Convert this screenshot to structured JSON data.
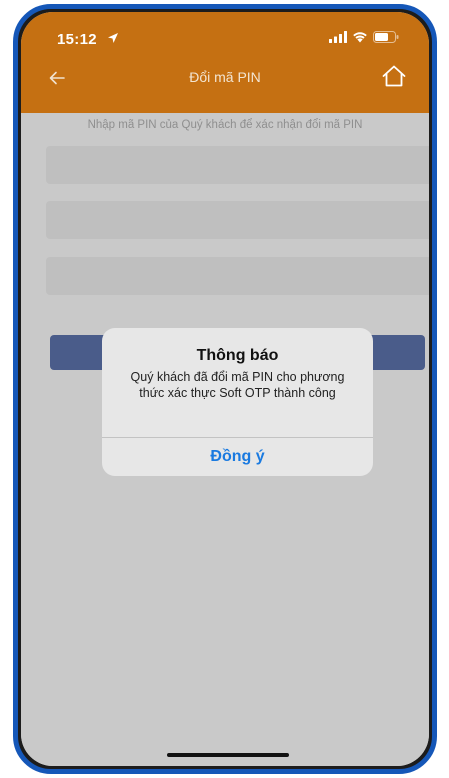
{
  "status_bar": {
    "time": "15:12",
    "icons": [
      "location-arrow-icon",
      "signal-icon",
      "wifi-icon",
      "battery-icon"
    ]
  },
  "nav": {
    "title": "Đổi mã PIN",
    "back_icon": "arrow-left-icon",
    "home_icon": "home-icon"
  },
  "form": {
    "instruction": "Nhập mã PIN của Quý khách để xác nhận đổi mã PIN",
    "fields": [
      {
        "value": "",
        "placeholder": ""
      },
      {
        "value": "",
        "placeholder": ""
      },
      {
        "value": "",
        "placeholder": ""
      }
    ]
  },
  "alert": {
    "title": "Thông báo",
    "message": "Quý khách đã đổi mã PIN cho phương thức xác thực Soft OTP thành công",
    "ok_label": "Đồng ý"
  },
  "colors": {
    "header": "#c57012",
    "frame": "#1557b8",
    "overlay": "#c9c9c9",
    "button": "#4a5c8a",
    "link": "#1a7ae0"
  }
}
